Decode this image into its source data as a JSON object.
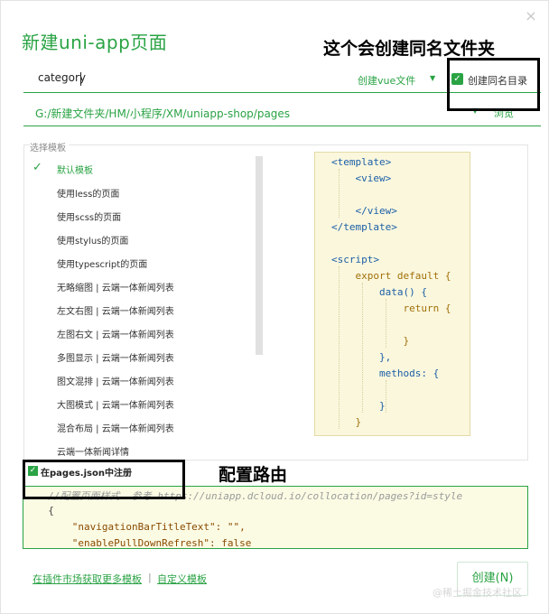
{
  "dialog": {
    "title": "新建uni-app页面",
    "close_icon": "×"
  },
  "annotations": {
    "same_name_folder": "这个会创建同名文件夹",
    "config_route": "配置路由"
  },
  "name_field": {
    "value": "category"
  },
  "file_type": {
    "selected": "创建vue文件",
    "arrow": "▼"
  },
  "create_same_dir": {
    "checked": true,
    "check_mark": "✓",
    "label": "创建同名目录"
  },
  "path": {
    "value": "G:/新建文件夹/HM/小程序/XM/uniapp-shop/pages",
    "arrow": "▼",
    "browse_label": "浏览"
  },
  "templates": {
    "legend": "选择模板",
    "check_mark": "✓",
    "items": [
      {
        "label": "默认模板",
        "selected": true
      },
      {
        "label": "使用less的页面"
      },
      {
        "label": "使用scss的页面"
      },
      {
        "label": "使用stylus的页面"
      },
      {
        "label": "使用typescript的页面"
      },
      {
        "label": "无略缩图 | 云端一体新闻列表"
      },
      {
        "label": "左文右图 | 云端一体新闻列表"
      },
      {
        "label": "左图右文 | 云端一体新闻列表"
      },
      {
        "label": "多图显示 | 云端一体新闻列表"
      },
      {
        "label": "图文混排 | 云端一体新闻列表"
      },
      {
        "label": "大图模式 | 云端一体新闻列表"
      },
      {
        "label": "混合布局 | 云端一体新闻列表"
      },
      {
        "label": "云端一体新闻详情"
      }
    ]
  },
  "preview": {
    "lines": [
      {
        "text": "<template>",
        "cls": "c-tag"
      },
      {
        "text": "    <view>",
        "cls": "c-tag"
      },
      {
        "text": "",
        "cls": "c-tag"
      },
      {
        "text": "    </view>",
        "cls": "c-tag"
      },
      {
        "text": "</template>",
        "cls": "c-tag"
      },
      {
        "text": "",
        "cls": "c-tag"
      },
      {
        "text": "<script>",
        "cls": "c-tag"
      },
      {
        "text": "    export default {",
        "cls": "c-kw"
      },
      {
        "text": "        data() {",
        "cls": "c-tag"
      },
      {
        "text": "            return {",
        "cls": "c-kw"
      },
      {
        "text": "",
        "cls": "c-tag"
      },
      {
        "text": "            }",
        "cls": "c-kw"
      },
      {
        "text": "        },",
        "cls": "c-tag"
      },
      {
        "text": "        methods: {",
        "cls": "c-tag"
      },
      {
        "text": "",
        "cls": "c-tag"
      },
      {
        "text": "        }",
        "cls": "c-tag"
      },
      {
        "text": "    }",
        "cls": "c-kw"
      }
    ]
  },
  "register_pages": {
    "checked": true,
    "check_mark": "✓",
    "label": "在pages.json中注册"
  },
  "pages_json": {
    "lines": [
      {
        "text": "  //配置页面样式  参考 https://uniapp.dcloud.io/collocation/pages?id=style",
        "cls": "j-comment"
      },
      {
        "text": "  {",
        "cls": "j-key"
      },
      {
        "text": "      \"navigationBarTitleText\": \"\",",
        "cls": "j-str"
      },
      {
        "text": "      \"enablePullDownRefresh\": false",
        "cls": "j-str"
      }
    ]
  },
  "footer": {
    "market_link": "在插件市场获取更多模板",
    "separator": "|",
    "custom_link": "自定义模板",
    "create_button": "创建(N)",
    "watermark": "@稀土掘金技术社区"
  }
}
